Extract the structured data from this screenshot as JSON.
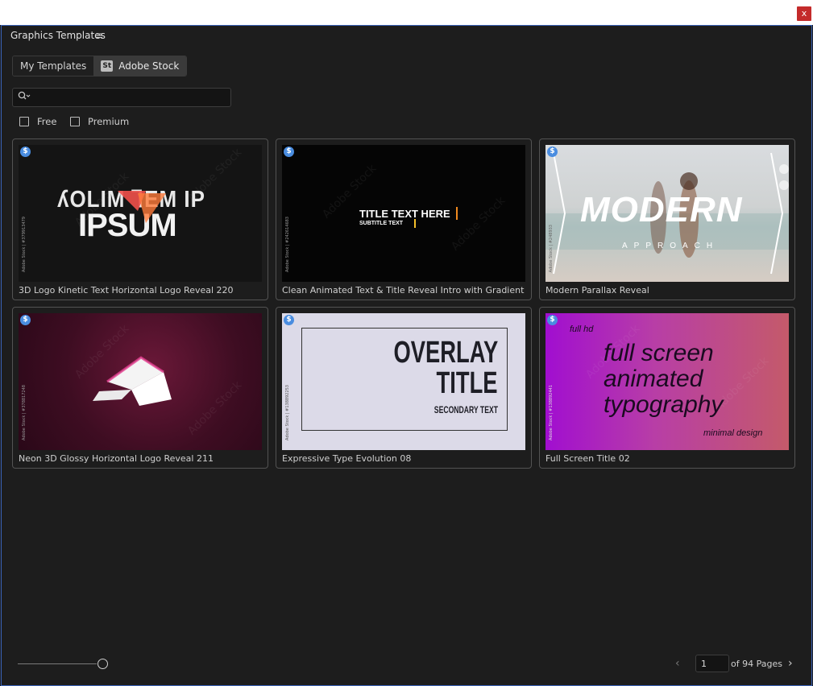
{
  "window": {
    "close_label": "x"
  },
  "panel": {
    "title": "Graphics Templates",
    "menu_glyph": "≡"
  },
  "tabs": [
    {
      "label": "My Templates",
      "active": false
    },
    {
      "badge": "St",
      "label": "Adobe Stock",
      "active": true
    }
  ],
  "search": {
    "icon": "search-icon",
    "caret": "⌄",
    "value": "",
    "placeholder": ""
  },
  "filters": [
    {
      "label": "Free",
      "checked": false
    },
    {
      "label": "Premium",
      "checked": false
    }
  ],
  "templates": [
    {
      "label": "3D Logo Kinetic Text Horizontal Logo Reveal 220",
      "badge": "$",
      "watermark": "Adobe Stock | #379913479",
      "art": {
        "line1": "ʎOLIM ⅂EM IP",
        "line2": "IPSUM",
        "accent": "#f0504a"
      }
    },
    {
      "label": "Clean Animated Text & Title Reveal Intro with Gradient",
      "badge": "$",
      "watermark": "Adobe Stock | #242614683",
      "art": {
        "title": "TITLE TEXT HERE",
        "subtitle": "SUBTITLE TEXT",
        "accent": "#f08a1e"
      }
    },
    {
      "label": "Modern Parallax Reveal",
      "badge": "$",
      "watermark": "Adobe Stock | #248933",
      "art": {
        "title": "MODERN",
        "subtitle": "APPROACH"
      }
    },
    {
      "label": "Neon 3D Glossy Horizontal Logo Reveal 211",
      "badge": "$",
      "watermark": "Adobe Stock | #378817248",
      "art": {
        "color": "#e23d8f"
      }
    },
    {
      "label": "Expressive Type Evolution 08",
      "badge": "$",
      "watermark": "Adobe Stock | #138892253",
      "art": {
        "line1": "OVERLAY",
        "line2": "TITLE",
        "line3": "SECONDARY TEXT"
      }
    },
    {
      "label": "Full Screen Title 02",
      "badge": "$",
      "watermark": "Adobe Stock | #138892441",
      "art": {
        "top": "full hd",
        "line1": "full screen",
        "line2": "animated",
        "line3": "typography",
        "bottom": "minimal design"
      }
    }
  ],
  "stock_watermark": "Adobe Stock",
  "pagination": {
    "current_page": "1",
    "of_label": "of 94 Pages",
    "prev": "‹",
    "next": "›"
  },
  "zoom_slider": {
    "value": 1.0
  }
}
